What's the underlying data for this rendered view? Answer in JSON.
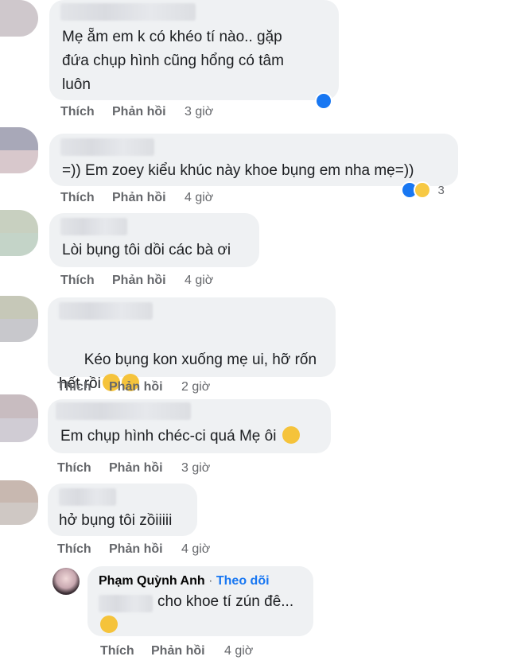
{
  "comments": [
    {
      "text": "Mẹ ẵm em k có khéo tí nào.. gặp\nđứa chụp hình cũng hổng có tâm\nluôn",
      "like": "Thích",
      "reply": "Phản hồi",
      "time": "3 giờ"
    },
    {
      "text": "=)) Em zoey kiểu khúc này khoe bụng em nha mẹ=))",
      "like": "Thích",
      "reply": "Phản hồi",
      "time": "4 giờ",
      "reaction_count": "3"
    },
    {
      "text": "Lòi bụng tôi dồi các bà ơi",
      "like": "Thích",
      "reply": "Phản hồi",
      "time": "4 giờ"
    },
    {
      "text": "Kéo bụng kon xuống mẹ ui, hỡ rốn\nhết rồi",
      "like": "Thích",
      "reply": "Phản hồi",
      "time": "2 giờ"
    },
    {
      "text": "Em chụp hình chéc-ci quá Mẹ ôi",
      "like": "Thích",
      "reply": "Phản hồi",
      "time": "3 giờ"
    },
    {
      "text": "hở bụng tôi zồiiiii",
      "like": "Thích",
      "reply": "Phản hồi",
      "time": "4 giờ"
    }
  ],
  "reply": {
    "author": "Phạm Quỳnh Anh",
    "separator": "·",
    "follow": "Theo dõi",
    "text": "cho khoe tí zún đê...",
    "like": "Thích",
    "reply": "Phản hồi",
    "time": "4 giờ"
  },
  "colors": {
    "bubble": "#eff1f3",
    "action_text": "#65676b",
    "follow_link": "#1877f2",
    "like_blue": "#1877f2"
  },
  "icons": [
    "like-icon",
    "haha-icon",
    "grin-sweat-emoji",
    "relieved-emoji",
    "smiling-hearts-emoji",
    "hushed-emoji"
  ]
}
